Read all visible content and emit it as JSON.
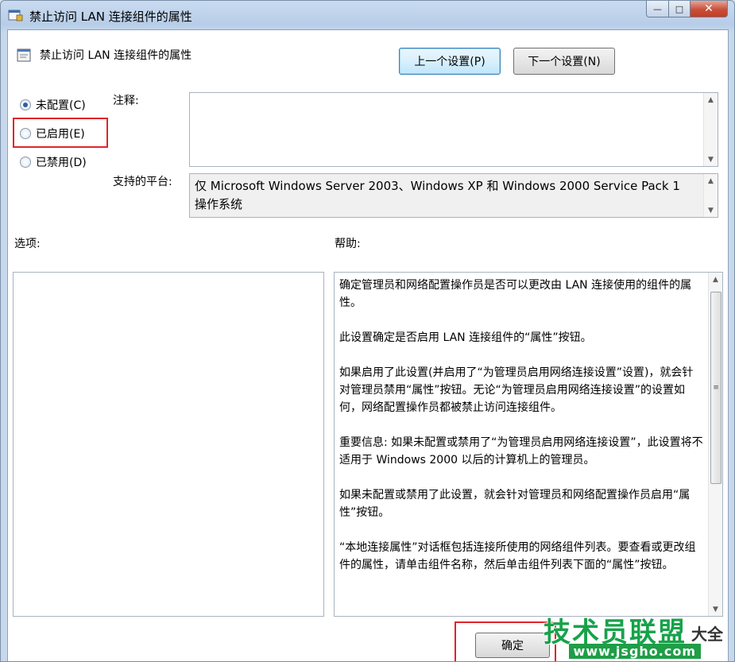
{
  "window": {
    "title": "禁止访问 LAN 连接组件的属性",
    "min_glyph": "—",
    "max_glyph": "□",
    "close_glyph": "✕"
  },
  "policy": {
    "name": "禁止访问 LAN 连接组件的属性",
    "prev_label": "上一个设置(P)",
    "next_label": "下一个设置(N)"
  },
  "state": {
    "options": [
      {
        "label": "未配置(C)",
        "checked": true
      },
      {
        "label": "已启用(E)",
        "checked": false
      },
      {
        "label": "已禁用(D)",
        "checked": false
      }
    ]
  },
  "comment": {
    "label": "注释:",
    "value": ""
  },
  "platform": {
    "label": "支持的平台:",
    "value": "仅 Microsoft Windows Server 2003、Windows XP 和 Windows 2000 Service Pack 1 操作系统"
  },
  "options_pane": {
    "label": "选项:"
  },
  "help_pane": {
    "label": "帮助:",
    "paragraphs": [
      "确定管理员和网络配置操作员是否可以更改由 LAN 连接使用的组件的属性。",
      "此设置确定是否启用 LAN 连接组件的“属性”按钮。",
      "如果启用了此设置(并启用了“为管理员启用网络连接设置”设置)，就会针对管理员禁用“属性”按钮。无论“为管理员启用网络连接设置”的设置如何，网络配置操作员都被禁止访问连接组件。",
      "重要信息: 如果未配置或禁用了“为管理员启用网络连接设置”，此设置将不适用于 Windows 2000 以后的计算机上的管理员。",
      "如果未配置或禁用了此设置，就会针对管理员和网络配置操作员启用“属性”按钮。",
      "“本地连接属性”对话框包括连接所使用的网络组件列表。要查看或更改组件的属性，请单击组件名称，然后单击组件列表下面的“属性”按钮。"
    ]
  },
  "footer": {
    "ok_label": "确定"
  },
  "watermark": {
    "main": "技术员联盟",
    "side": "大全",
    "url": "www.jsgho.com"
  },
  "icons": {
    "title": "policy-icon",
    "scroll_up": "▲",
    "scroll_down": "▼",
    "grip": "≡"
  },
  "colors": {
    "highlight_box": "#e0252a",
    "watermark_green": "#17a24a"
  }
}
